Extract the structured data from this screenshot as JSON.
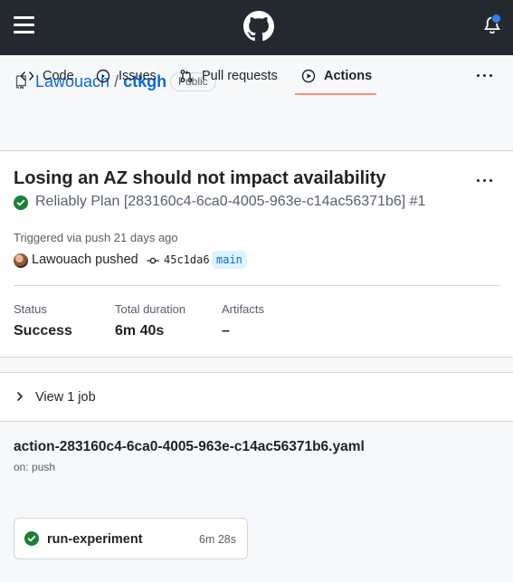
{
  "topbar": {
    "menu_icon": "hamburger-icon",
    "logo_icon": "github-logo-icon",
    "notification_icon": "bell-icon",
    "notification_dot_color": "#2f81f7"
  },
  "repo": {
    "owner": "Lawouach",
    "separator": "/",
    "name": "ctkgh",
    "visibility": "Public"
  },
  "tabs": [
    {
      "label": "Code",
      "icon": "code-icon",
      "active": false
    },
    {
      "label": "Issues",
      "icon": "issue-icon",
      "active": false
    },
    {
      "label": "Pull requests",
      "icon": "pull-request-icon",
      "active": false
    },
    {
      "label": "Actions",
      "icon": "play-icon",
      "active": true
    }
  ],
  "run": {
    "title": "Losing an AZ should not impact availability",
    "subtitle": "Reliably Plan [283160c4-6ca0-4005-963e-c14ac56371b6] #1",
    "triggered": "Triggered via push 21 days ago",
    "actor": "Lawouach pushed",
    "commit_sha": "45c1da6",
    "branch": "main",
    "stats": {
      "status_label": "Status",
      "status_value": "Success",
      "duration_label": "Total duration",
      "duration_value": "6m 40s",
      "artifacts_label": "Artifacts",
      "artifacts_value": "–"
    }
  },
  "jobs": {
    "toggle_label": "View 1 job"
  },
  "workflow": {
    "file": "action-283160c4-6ca0-4005-963e-c14ac56371b6.yaml",
    "trigger": "on: push",
    "job": {
      "name": "run-experiment",
      "duration": "6m 28s"
    }
  },
  "colors": {
    "success": "#1a7f37",
    "link": "#0969da",
    "active_tab_underline": "#fd8c73"
  }
}
